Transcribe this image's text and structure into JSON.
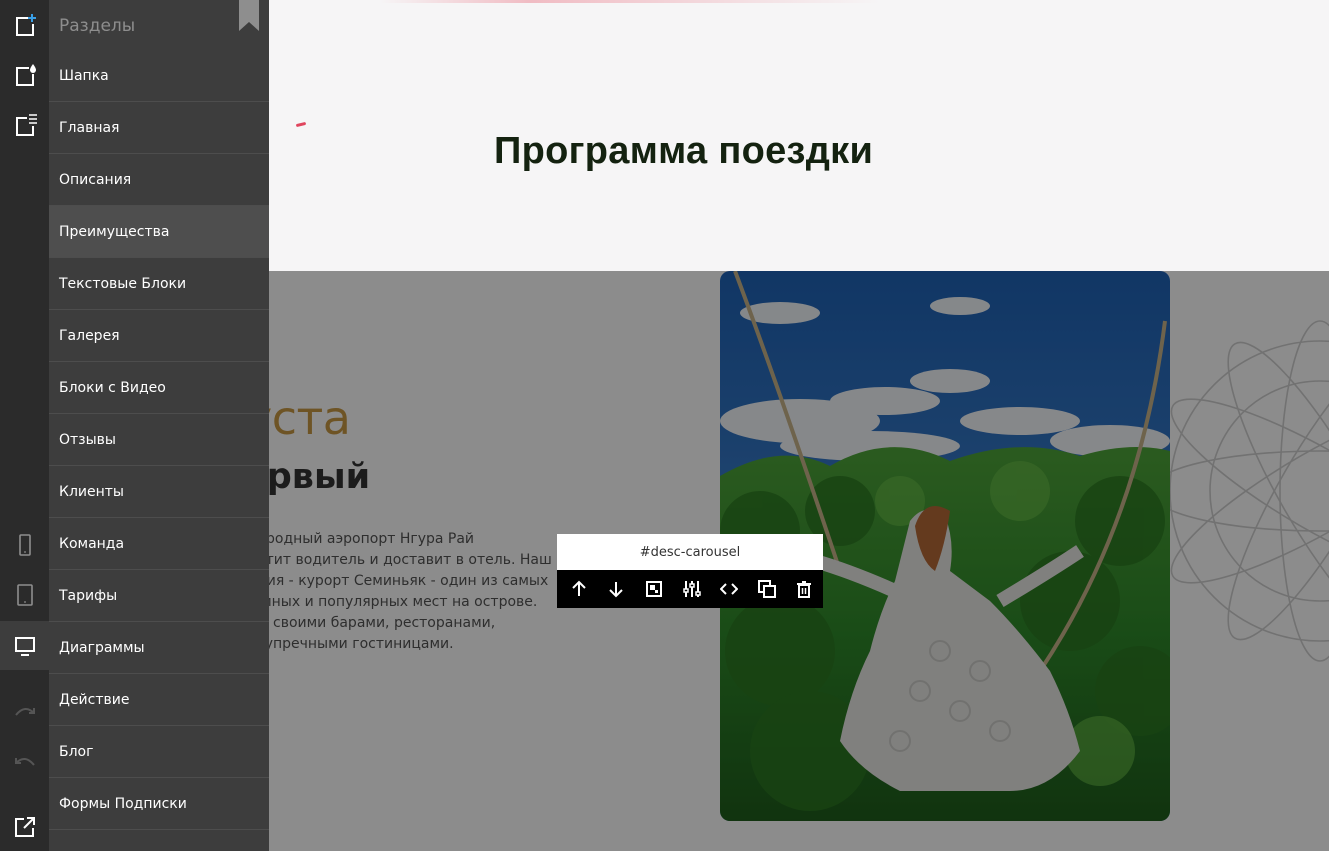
{
  "page": {
    "section_title": "Программа поездки",
    "desc": {
      "date_fragment": "уста",
      "heading_fragment": "ервый",
      "text_lines": [
        "ународный аэропорт Нгура Рай",
        "третит водитель и доставит в отель. Наш",
        "ления - курорт Семиньяк - один из самых",
        "шумных и популярных мест на острове.",
        "мир своими барами, ресторанами,",
        "безупречными гостиницами."
      ]
    }
  },
  "block_toolbar": {
    "block_id": "#desc-carousel",
    "tools": [
      {
        "name": "move-up-icon"
      },
      {
        "name": "move-down-icon"
      },
      {
        "name": "resize-icon"
      },
      {
        "name": "settings-sliders-icon"
      },
      {
        "name": "code-icon"
      },
      {
        "name": "duplicate-icon"
      },
      {
        "name": "delete-icon"
      }
    ]
  },
  "rail": {
    "top_buttons": [
      {
        "name": "add-section-icon",
        "color": "#3aa0e8"
      },
      {
        "name": "section-style-icon"
      },
      {
        "name": "section-list-icon"
      }
    ],
    "device_buttons": [
      {
        "name": "mobile-view-icon"
      },
      {
        "name": "tablet-view-icon"
      },
      {
        "name": "desktop-view-icon",
        "active": true
      }
    ],
    "history_buttons": [
      {
        "name": "redo-icon"
      },
      {
        "name": "undo-icon"
      }
    ],
    "bottom_button": {
      "name": "external-link-icon"
    }
  },
  "panel": {
    "title": "Разделы",
    "items": [
      {
        "label": "Шапка"
      },
      {
        "label": "Главная"
      },
      {
        "label": "Описания"
      },
      {
        "label": "Преимущества",
        "hover": true
      },
      {
        "label": "Текстовые Блоки"
      },
      {
        "label": "Галерея"
      },
      {
        "label": "Блоки с Видео"
      },
      {
        "label": "Отзывы"
      },
      {
        "label": "Клиенты"
      },
      {
        "label": "Команда"
      },
      {
        "label": "Тарифы"
      },
      {
        "label": "Диаграммы"
      },
      {
        "label": "Действие"
      },
      {
        "label": "Блог"
      },
      {
        "label": "Формы Подписки"
      }
    ]
  },
  "colors": {
    "rail_bg": "#2b2b2b",
    "panel_bg": "#3d3d3d",
    "accent": "#3aa0e8",
    "title_color": "#142210",
    "date_color": "#c99a44"
  }
}
